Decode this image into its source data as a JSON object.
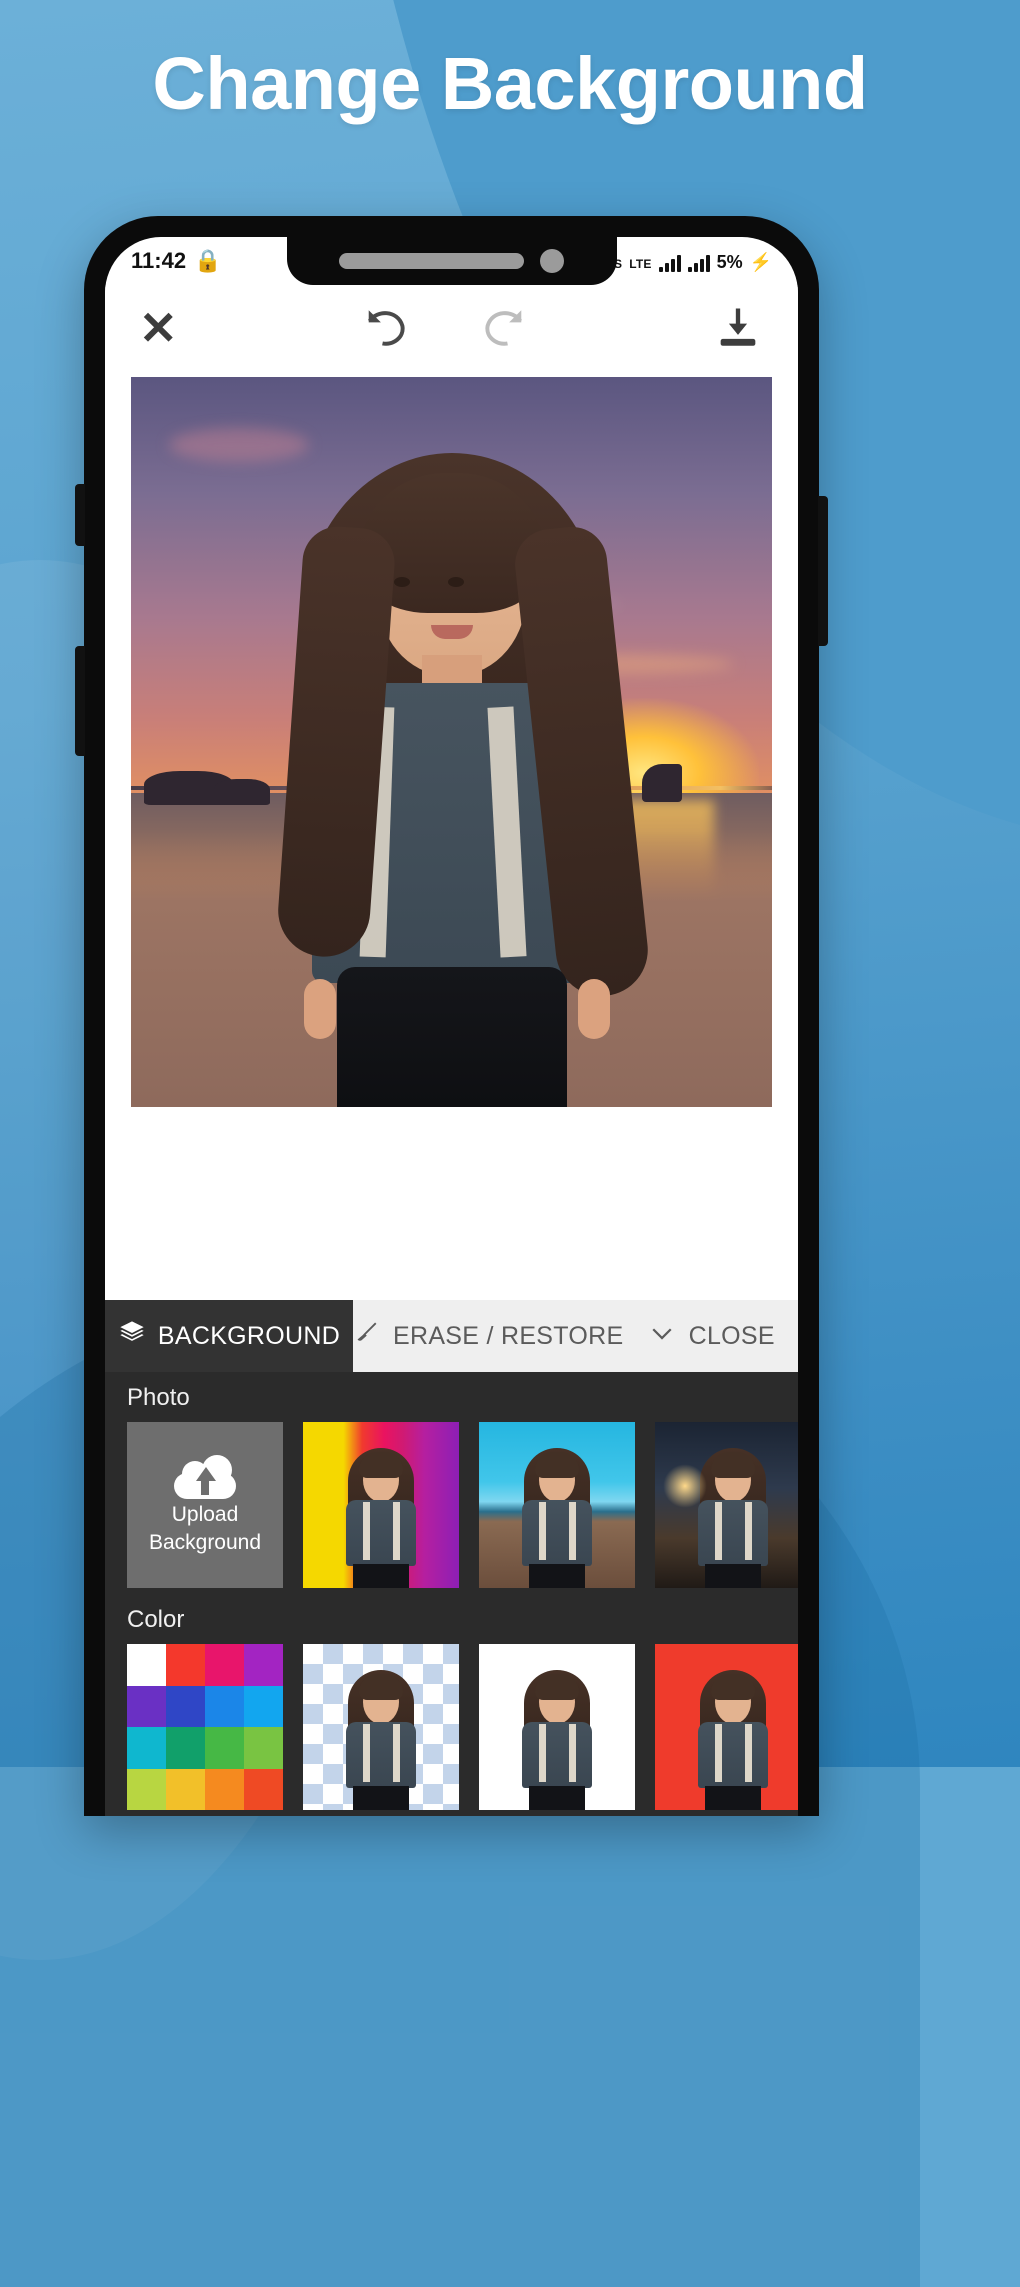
{
  "promo": {
    "headline": "Change Background",
    "bg_color": "#5fa8d3",
    "accent_color": "#4e9ccc"
  },
  "phone": {
    "statusbar": {
      "time": "11:42",
      "net_speed_unit": "KB/S",
      "data_label": "LTE",
      "battery_percent": "5%",
      "charging_glyph": "⚡"
    },
    "toolbar": {
      "close_icon": "close-x-icon",
      "undo_icon": "undo-icon",
      "redo_icon": "redo-icon",
      "download_icon": "download-icon"
    },
    "canvas": {
      "description": "sunset-beach-background-with-girl-cutout"
    },
    "tabs": [
      {
        "id": "background",
        "label": "BACKGROUND",
        "icon": "layers-icon",
        "active": true
      },
      {
        "id": "erase-restore",
        "label": "ERASE / RESTORE",
        "icon": "brush-icon",
        "active": false
      },
      {
        "id": "close",
        "label": "CLOSE",
        "icon": "chevron-down-icon",
        "active": false
      }
    ],
    "sections": [
      {
        "id": "photo",
        "title": "Photo",
        "items": [
          {
            "id": "upload",
            "type": "upload",
            "icon": "cloud-upload-icon",
            "line1": "Upload",
            "line2": "Background"
          },
          {
            "id": "stripes",
            "type": "preview",
            "style": "bg-stripes",
            "label": "colored-stripes-background"
          },
          {
            "id": "beach-pier",
            "type": "preview",
            "style": "bg-beach",
            "label": "beach-pier-background"
          },
          {
            "id": "city-bokeh",
            "type": "preview",
            "style": "bg-city",
            "label": "city-bokeh-background"
          }
        ]
      },
      {
        "id": "color",
        "title": "Color",
        "items": [
          {
            "id": "palette",
            "type": "palette",
            "label": "color-palette-picker",
            "swatches": [
              "#ffffff",
              "#f4382c",
              "#e8156b",
              "#a324c2",
              "#6a30c4",
              "#2f46c6",
              "#1b86e8",
              "#12a6ef",
              "#0fb7cf",
              "#11a06a",
              "#46b845",
              "#79c442",
              "#b8d641",
              "#f2c029",
              "#f58a1f",
              "#ef4a24"
            ]
          },
          {
            "id": "transparent",
            "type": "preview",
            "style": "bg-checker",
            "label": "transparent-background"
          },
          {
            "id": "white",
            "type": "preview",
            "style": "bg-white",
            "label": "white-background"
          },
          {
            "id": "red",
            "type": "preview",
            "style": "bg-red",
            "label": "red-background"
          }
        ]
      }
    ]
  }
}
